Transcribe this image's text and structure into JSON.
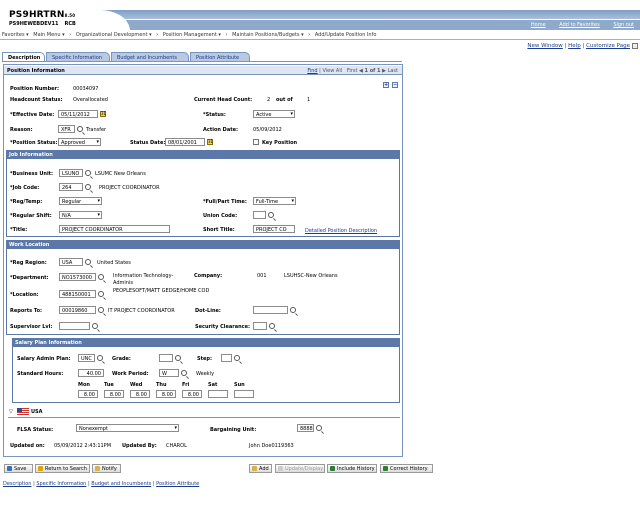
{
  "header": {
    "app_name": "PS9HRTRN",
    "app_version": "8.50",
    "db_name": "PS9HEWEBDEV11",
    "db_tag": "RCB",
    "links": [
      "Home",
      "Add to Favorites",
      "Sign out"
    ]
  },
  "menubar": [
    "Favorites ▾",
    "Main Menu ▾",
    "›",
    "Organizational Development ▾",
    "›",
    "Position Management ▾",
    "›",
    "Maintain Positions/Budgets ▾",
    "›",
    "Add/Update Position Info"
  ],
  "right_links": [
    "New Window",
    "Help",
    "Customize Page"
  ],
  "tabs": [
    {
      "label": "Description",
      "active": true
    },
    {
      "label": "Specific Information",
      "active": false
    },
    {
      "label": "Budget and Incumbents",
      "active": false
    },
    {
      "label": "Position Attribute",
      "active": false
    }
  ],
  "position_info": {
    "title": "Position Information",
    "nav": {
      "find": "Find",
      "view_all": "View All",
      "first": "First",
      "range": "1 of 1",
      "last": "Last"
    },
    "position_number_label": "Position Number:",
    "position_number": "00034097",
    "headcount_status_label": "Headcount Status:",
    "headcount_status": "Overallocated",
    "current_head_count_label": "Current Head Count:",
    "current_head_count": "2",
    "out_of_label": "out of",
    "out_of": "1",
    "effective_date_label": "*Effective Date:",
    "effective_date": "05/11/2012",
    "status_label": "*Status:",
    "status": "Active",
    "reason_label": "Reason:",
    "reason_code": "XFR",
    "reason_desc": "Transfer",
    "action_date_label": "Action Date:",
    "action_date": "05/09/2012",
    "position_status_label": "*Position Status:",
    "position_status": "Approved",
    "status_date_label": "Status Date:",
    "status_date": "08/01/2001",
    "key_position_label": "Key Position"
  },
  "job_info": {
    "title": "Job Information",
    "business_unit_label": "*Business Unit:",
    "business_unit": "LSUNO",
    "business_unit_desc": "LSUMC New Orleans",
    "job_code_label": "*Job Code:",
    "job_code": "264",
    "job_code_desc": "PROJECT COORDINATOR",
    "reg_temp_label": "*Reg/Temp:",
    "reg_temp": "Regular",
    "full_part_label": "*Full/Part Time:",
    "full_part": "Full-Time",
    "regular_shift_label": "*Regular Shift:",
    "regular_shift": "N/A",
    "union_code_label": "Union Code:",
    "union_code": "",
    "title_label": "*Title:",
    "title_value": "PROJECT COORDINATOR",
    "short_title_label": "Short Title:",
    "short_title": "PROJECT CO",
    "detailed_desc_link": "Detailed Position Description"
  },
  "work_location": {
    "title": "Work Location",
    "reg_region_label": "*Reg Region:",
    "reg_region": "USA",
    "reg_region_desc": "United States",
    "department_label": "*Department:",
    "department": "NO1573000",
    "department_desc1": "Information Technology-",
    "department_desc2": "Adminis",
    "company_label": "Company:",
    "company": "001",
    "company_desc": "LSUHSC-New Orleans",
    "location_label": "*Location:",
    "location": "488150001",
    "location_desc": "PEOPLESOFT/MATT GEDGE/HOME COD",
    "reports_to_label": "Reports To:",
    "reports_to": "00019860",
    "reports_to_desc": "IT PROJECT COORDINATOR",
    "dot_line_label": "Dot-Line:",
    "dot_line": "",
    "supervisor_lvl_label": "Supervisor Lvl:",
    "supervisor_lvl": "",
    "security_clearance_label": "Security Clearance:",
    "security_clearance": ""
  },
  "salary_plan": {
    "title": "Salary Plan Information",
    "admin_plan_label": "Salary Admin Plan:",
    "admin_plan": "UNC",
    "grade_label": "Grade:",
    "grade": "",
    "step_label": "Step:",
    "step": "",
    "std_hours_label": "Standard Hours:",
    "std_hours": "40.00",
    "work_period_label": "Work Period:",
    "work_period": "W",
    "work_period_desc": "Weekly",
    "days": [
      "Mon",
      "Tue",
      "Wed",
      "Thu",
      "Fri",
      "Sat",
      "Sun"
    ],
    "hours": [
      "8.00",
      "8.00",
      "8.00",
      "8.00",
      "8.00",
      "",
      ""
    ]
  },
  "usa": {
    "label": "USA",
    "flsa_label": "FLSA Status:",
    "flsa": "Nonexempt",
    "bargaining_label": "Bargaining Unit:",
    "bargaining": "8888",
    "updated_on_label": "Updated on:",
    "updated_on": "05/09/2012  2:43:11PM",
    "updated_by_label": "Updated By:",
    "updated_by": "CHAROL",
    "updated_by_name": "John Doe0119363"
  },
  "toolbar": {
    "save": "Save",
    "return_to_search": "Return to Search",
    "notify": "Notify",
    "add": "Add",
    "update_display": "Update/Display",
    "include_history": "Include History",
    "correct_history": "Correct History"
  },
  "footer_links": [
    "Description",
    "Specific Information",
    "Budget and Incumbents",
    "Position Attribute"
  ],
  "colors": {
    "accent": "#5b78a8",
    "header_band": "#8fa9cb",
    "link": "#1a3b8c"
  }
}
